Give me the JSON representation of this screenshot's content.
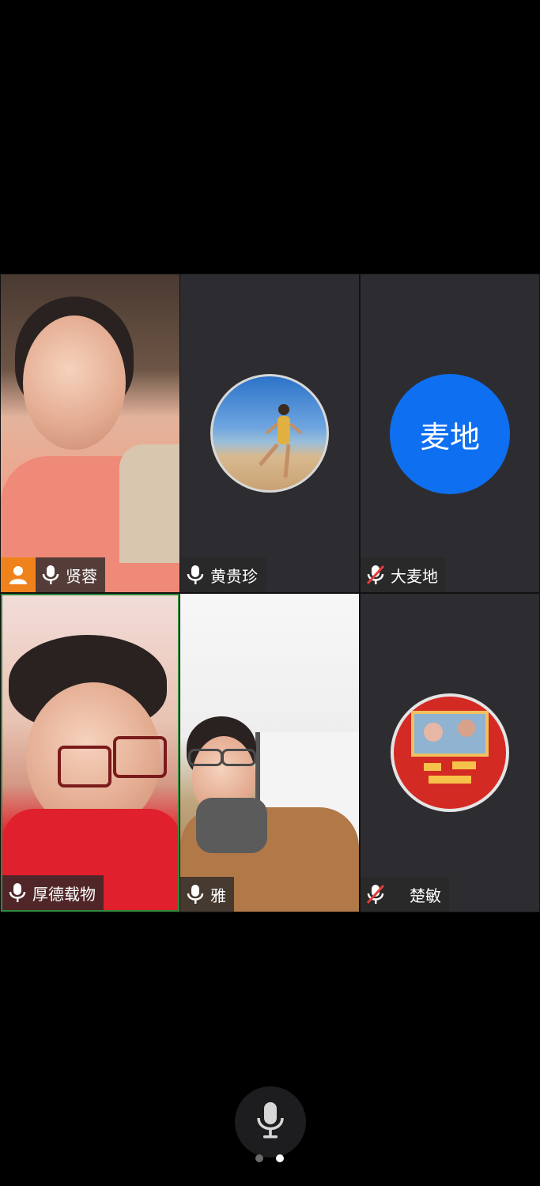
{
  "participants": [
    {
      "name": "贤蓉",
      "mic": "on",
      "is_host": true,
      "view": "video"
    },
    {
      "name": "黄贵珍",
      "mic": "on",
      "view": "avatar-photo"
    },
    {
      "name": "大麦地",
      "mic": "muted",
      "view": "avatar-text",
      "avatar_text": "麦地",
      "avatar_color": "#0e6ff1"
    },
    {
      "name": "厚德载物",
      "mic": "on",
      "view": "video",
      "active_speaker": true
    },
    {
      "name": "雅",
      "mic": "on",
      "view": "video"
    },
    {
      "name": "楚敏",
      "mic": "muted",
      "view": "avatar-photo"
    }
  ],
  "avatar_texts": {
    "t6_poster": [
      "健康",
      "好运",
      "暴富",
      "开心"
    ]
  },
  "controls": {
    "mic_button": "microphone-icon"
  },
  "pager": {
    "total": 2,
    "current": 2
  },
  "colors": {
    "host_badge": "#f0821c",
    "active_border": "#2f8a3b",
    "tile_bg": "#2d2d31",
    "muted_slash": "#e33b3b"
  }
}
